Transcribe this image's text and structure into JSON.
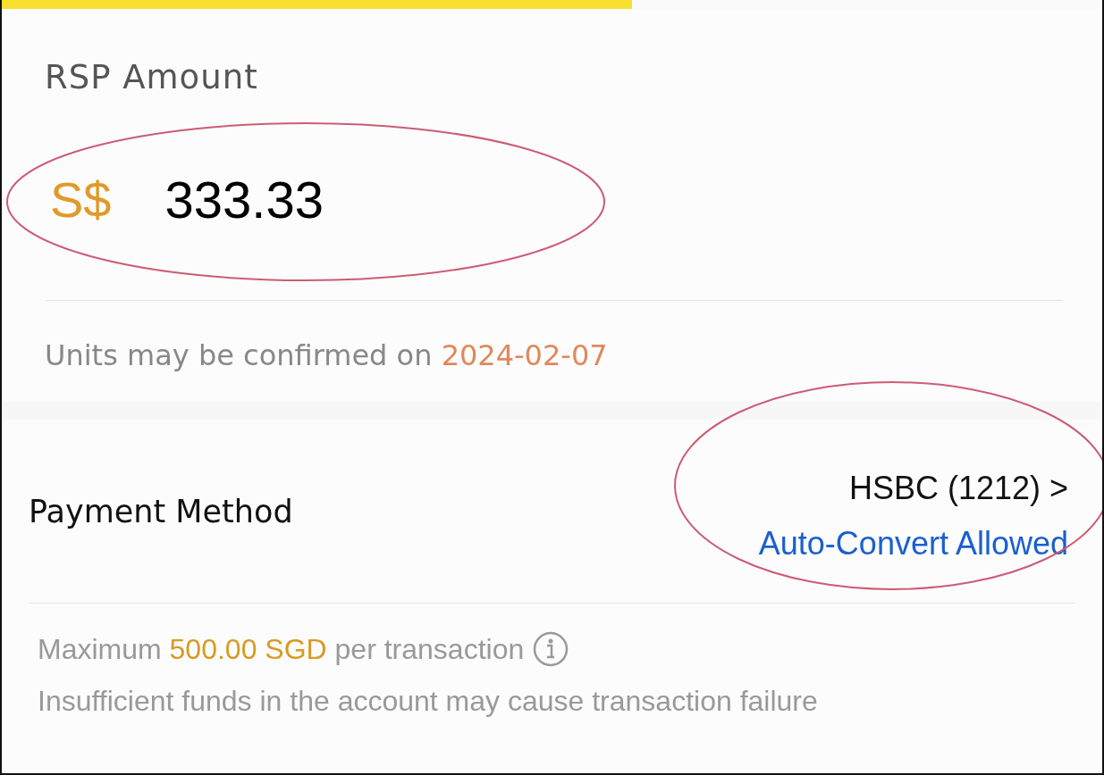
{
  "progress": {
    "level": 0.573
  },
  "amount": {
    "label": "RSP Amount",
    "currency": "S$",
    "value": "333.33",
    "note": {
      "text": "Units may be confirmed on ",
      "highlight": "2024-02-07"
    }
  },
  "payment": {
    "label": "Payment Method",
    "account": "HSBC (1212)",
    "chevron": ">",
    "status": "Auto-Convert Allowed"
  },
  "notes": [
    {
      "text": "Maximum ",
      "highlight": "500.00 SGD",
      "after": " per transaction",
      "info": true
    },
    {
      "text": "Insufficient funds in the account may cause transaction failure",
      "info": false
    }
  ]
}
